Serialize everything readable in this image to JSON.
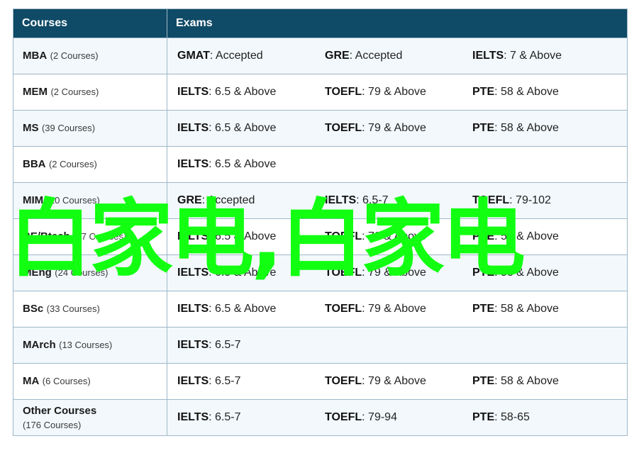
{
  "table": {
    "headers": [
      "Courses",
      "Exams"
    ],
    "rows": [
      {
        "course": "MBA",
        "count": "(2 Courses)",
        "exams": [
          {
            "name": "GMAT",
            "value": ": Accepted"
          },
          {
            "name": "GRE",
            "value": ": Accepted"
          },
          {
            "name": "IELTS",
            "value": ": 7 & Above"
          }
        ]
      },
      {
        "course": "MEM",
        "count": "(2 Courses)",
        "exams": [
          {
            "name": "IELTS",
            "value": ": 6.5 & Above"
          },
          {
            "name": "TOEFL",
            "value": ": 79 & Above"
          },
          {
            "name": "PTE",
            "value": ": 58 & Above"
          }
        ]
      },
      {
        "course": "MS",
        "count": "(39 Courses)",
        "exams": [
          {
            "name": "IELTS",
            "value": ": 6.5 & Above"
          },
          {
            "name": "TOEFL",
            "value": ": 79 & Above"
          },
          {
            "name": "PTE",
            "value": ": 58 & Above"
          }
        ]
      },
      {
        "course": "BBA",
        "count": "(2 Courses)",
        "exams": [
          {
            "name": "IELTS",
            "value": ": 6.5 & Above"
          }
        ]
      },
      {
        "course": "MIM",
        "count": "(20 Courses)",
        "exams": [
          {
            "name": "GRE",
            "value": ": Accepted"
          },
          {
            "name": "IELTS",
            "value": ": 6.5-7"
          },
          {
            "name": "TOEFL",
            "value": ": 79-102"
          }
        ]
      },
      {
        "course": "BE/Btech",
        "count": "(17 Courses)",
        "exams": [
          {
            "name": "IELTS",
            "value": ": 6.5 & Above"
          },
          {
            "name": "TOEFL",
            "value": ": 79 & Above"
          },
          {
            "name": "PTE",
            "value": ": 58 & Above"
          }
        ]
      },
      {
        "course": "MEng",
        "count": "(24 Courses)",
        "exams": [
          {
            "name": "IELTS",
            "value": ": 6.5 & Above"
          },
          {
            "name": "TOEFL",
            "value": ": 79 & Above"
          },
          {
            "name": "PTE",
            "value": ": 58 & Above"
          }
        ]
      },
      {
        "course": "BSc",
        "count": "(33 Courses)",
        "exams": [
          {
            "name": "IELTS",
            "value": ": 6.5 & Above"
          },
          {
            "name": "TOEFL",
            "value": ": 79 & Above"
          },
          {
            "name": "PTE",
            "value": ": 58 & Above"
          }
        ]
      },
      {
        "course": "MArch",
        "count": "(13 Courses)",
        "exams": [
          {
            "name": "IELTS",
            "value": ": 6.5-7"
          }
        ]
      },
      {
        "course": "MA",
        "count": "(6 Courses)",
        "exams": [
          {
            "name": "IELTS",
            "value": ": 6.5-7"
          },
          {
            "name": "TOEFL",
            "value": ": 79 & Above"
          },
          {
            "name": "PTE",
            "value": ": 58 & Above"
          }
        ]
      },
      {
        "course": "Other Courses",
        "count": "(176 Courses)",
        "count_on_new_line": true,
        "exams": [
          {
            "name": "IELTS",
            "value": ": 6.5-7"
          },
          {
            "name": "TOEFL",
            "value": ": 79-94"
          },
          {
            "name": "PTE",
            "value": ": 58-65"
          }
        ]
      }
    ]
  },
  "overlay": {
    "text": "白家电,白家电",
    "color": "#12ff12"
  },
  "colors": {
    "header_bg": "#0f4a66",
    "row_alt_bg": "#f2f8fc",
    "border": "#9fb8c8"
  }
}
